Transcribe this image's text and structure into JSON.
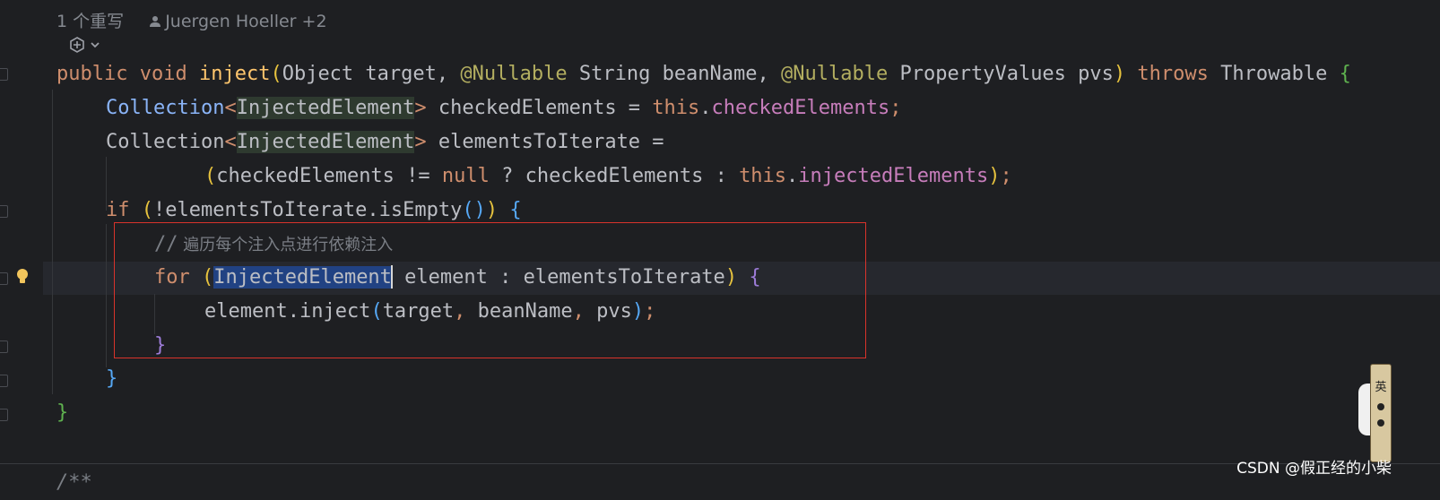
{
  "meta": {
    "overrides": "1 个重写",
    "authors": "Juergen Hoeller +2"
  },
  "code": {
    "l1": {
      "kw1": "public",
      "kw2": "void",
      "fn": "inject",
      "p1": "(",
      "t1": "Object target, ",
      "ann1": "@Nullable",
      "t2": " String beanName, ",
      "ann2": "@Nullable",
      "t3": " PropertyValues pvs",
      "p2": ")",
      "kw3": "throws",
      "t4": " Throwable ",
      "br": "{"
    },
    "l2": {
      "type": "Collection",
      "lt": "<",
      "gen": "InjectedElement",
      "gt": ">",
      "t1": " checkedElements = ",
      "kw": "this",
      "dot": ".",
      "field": "checkedElements",
      "semi": ";"
    },
    "l3": {
      "type": "Collection",
      "lt": "<",
      "gen": "InjectedElement",
      "gt": ">",
      "t1": " elementsToIterate ="
    },
    "l4": {
      "p1": "(",
      "t1": "checkedElements != ",
      "kw1": "null",
      "t2": " ? checkedElements : ",
      "kw2": "this",
      "dot": ".",
      "field": "injectedElements",
      "p2": ")",
      "semi": ";"
    },
    "l5": {
      "kw": "if",
      "p1": "(",
      "t1": "!elementsToIterate.isEmpty",
      "p2": "()",
      "p3": ")",
      "br": "{"
    },
    "l6": {
      "slashes": "//",
      "comment": " 遍历每个注入点进行依赖注入"
    },
    "l7": {
      "kw": "for",
      "p1": "(",
      "sel": "InjectedElement",
      "t1": " element : elementsToIterate",
      "p2": ")",
      "br": "{"
    },
    "l8": {
      "t1": "element.inject",
      "p1": "(",
      "t2": "target",
      "c1": ",",
      "t3": " beanName",
      "c2": ",",
      "t4": " pvs",
      "p2": ")",
      "semi": ";"
    },
    "l9": {
      "br": "}"
    },
    "l10": {
      "br": "}"
    },
    "l11": {
      "br": "}"
    },
    "l12": {
      "doc": "/**"
    }
  },
  "watermark": "CSDN @假正经的小柴",
  "ime": {
    "label": "英"
  },
  "colors": {
    "background": "#1e1f22",
    "keyword": "#cf8e6d",
    "annotation": "#b3ae60",
    "function": "#56a8f5",
    "field": "#c77dbb",
    "highlight_box": "#d9332b",
    "selection": "#214283"
  }
}
